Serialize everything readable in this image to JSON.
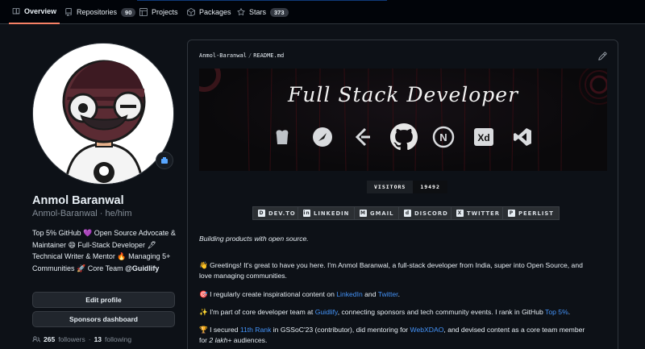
{
  "nav": {
    "tabs": [
      {
        "label": "Overview",
        "icon": "book-icon",
        "active": true
      },
      {
        "label": "Repositories",
        "icon": "repo-icon",
        "count": "90"
      },
      {
        "label": "Projects",
        "icon": "table-icon"
      },
      {
        "label": "Packages",
        "icon": "package-icon"
      },
      {
        "label": "Stars",
        "icon": "star-icon",
        "count": "373"
      }
    ]
  },
  "profile": {
    "name": "Anmol Baranwal",
    "login": "Anmol-Baranwal · he/him",
    "bio_parts": {
      "p1": "Top 5% GitHub ",
      "p2": " Open Source Advocate & Maintainer ",
      "p3": " Full-Stack Developer ",
      "p4": " Technical Writer & Mentor ",
      "p5": " Managing 5+ Communities ",
      "p6": " Core Team ",
      "org": "@Guidlify"
    },
    "edit_profile": "Edit profile",
    "sponsors_dashboard": "Sponsors dashboard",
    "followers_count": "265",
    "followers_label": "followers",
    "following_count": "13",
    "following_label": "following"
  },
  "readme": {
    "owner": "Anmol-Baranwal",
    "file": "README.md",
    "banner_title": "Full Stack Developer",
    "tech_icons": [
      "chef-icon",
      "swift-icon",
      "leetcode-icon",
      "github-icon",
      "nextjs-icon",
      "xd-icon",
      "vscode-icon"
    ],
    "visitors_label": "VISITORS",
    "visitors_count": "19492",
    "socials": [
      {
        "label": "DEV.TO",
        "icon": "devto-icon",
        "glyph": "D"
      },
      {
        "label": "LINKEDIN",
        "icon": "linkedin-icon",
        "glyph": "in"
      },
      {
        "label": "GMAIL",
        "icon": "gmail-icon",
        "glyph": "M"
      },
      {
        "label": "DISCORD",
        "icon": "discord-icon",
        "glyph": "d"
      },
      {
        "label": "TWITTER",
        "icon": "x-icon",
        "glyph": "X"
      },
      {
        "label": "PEERLIST",
        "icon": "peerlist-icon",
        "glyph": "P"
      }
    ],
    "tagline": "Building products with open source.",
    "greeting": "👋 Greetings! It's great to have you here. I'm Anmol Baranwal, a full-stack developer from India, super into Open Source, and love managing communities.",
    "content_line": {
      "pre": "🎯 I regularly create inspirational content on ",
      "link1": "LinkedIn",
      "mid": " and ",
      "link2": "Twitter",
      "post": "."
    },
    "core_line": {
      "pre": "✨ I'm part of core developer team at ",
      "link1": "Guidlify",
      "mid": ", connecting sponsors and tech community events. I rank in GitHub ",
      "link2": "Top 5%",
      "post": "."
    },
    "gssoc_line": {
      "pre": "🏆 I secured ",
      "link1": "11th Rank",
      "mid": " in GSSoC'23 (contributor), did mentoring for ",
      "link2": "WebXDAO",
      "post": ", and devised content as a core team member for ",
      "em": "2 lakh+",
      "end": " audiences."
    }
  },
  "colors": {
    "accent_tab": "#f78166",
    "link": "#4493f8",
    "background": "#0d1117"
  }
}
